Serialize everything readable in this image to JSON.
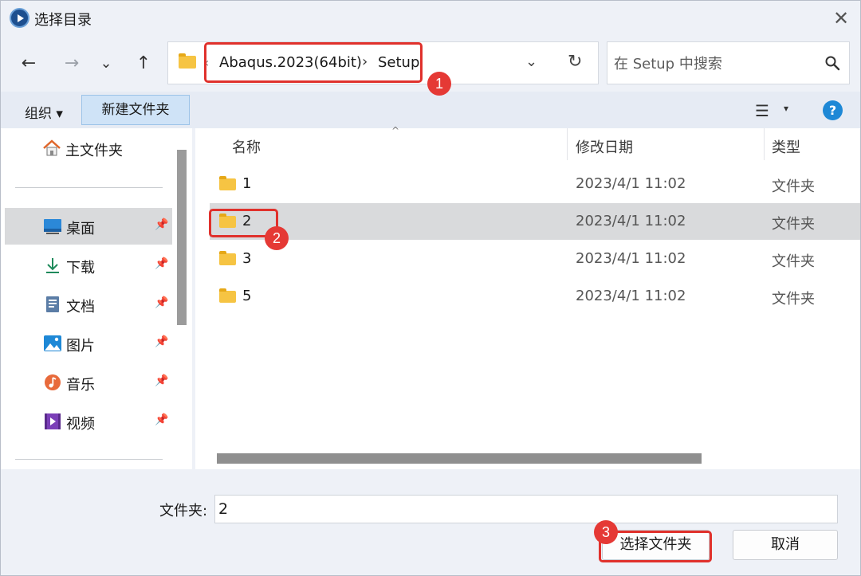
{
  "window": {
    "title": "选择目录",
    "close_glyph": "✕"
  },
  "nav": {
    "back": "←",
    "forward": "→",
    "recent": "⌄",
    "up": "↑"
  },
  "address": {
    "lt": "‹",
    "crumbs": [
      "Abaqus.2023(64bit)",
      "Setup"
    ],
    "sep": "›",
    "dropdown": "⌄",
    "refresh": "↻"
  },
  "search": {
    "placeholder": "在 Setup 中搜索"
  },
  "toolbar": {
    "organize_label": "组织 ▾",
    "new_folder_label": "新建文件夹",
    "view_glyph": "☰",
    "view_caret": "▾",
    "help_label": "?"
  },
  "sidebar": {
    "home_label": "主文件夹",
    "pin_glyph": "📌",
    "items": [
      {
        "label": "桌面",
        "icon": "desktop-icon"
      },
      {
        "label": "下载",
        "icon": "download-icon"
      },
      {
        "label": "文档",
        "icon": "document-icon"
      },
      {
        "label": "图片",
        "icon": "picture-icon"
      },
      {
        "label": "音乐",
        "icon": "music-icon"
      },
      {
        "label": "视频",
        "icon": "video-icon"
      }
    ]
  },
  "filelist": {
    "columns": {
      "name": "名称",
      "modified": "修改日期",
      "type": "类型"
    },
    "sort_caret": "^",
    "rows": [
      {
        "name": "1",
        "modified": "2023/4/1 11:02",
        "type": "文件夹"
      },
      {
        "name": "2",
        "modified": "2023/4/1 11:02",
        "type": "文件夹"
      },
      {
        "name": "3",
        "modified": "2023/4/1 11:02",
        "type": "文件夹"
      },
      {
        "name": "5",
        "modified": "2023/4/1 11:02",
        "type": "文件夹"
      }
    ]
  },
  "footer": {
    "folder_label": "文件夹:",
    "folder_value": "2",
    "select_button": "选择文件夹",
    "cancel_button": "取消"
  },
  "annotations": {
    "badge1": "1",
    "badge2": "2",
    "badge3": "3",
    "color": "#e53935"
  }
}
